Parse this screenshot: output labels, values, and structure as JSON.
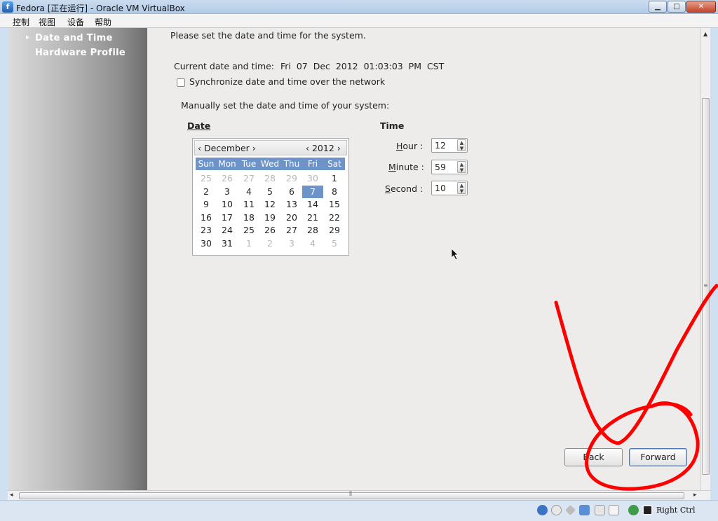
{
  "window": {
    "title": "Fedora [正在运行] - Oracle VM VirtualBox",
    "icon": "virtualbox-icon",
    "controls": {
      "minimize": "▁",
      "maximize": "□",
      "close": "✕"
    }
  },
  "menubar": {
    "items": [
      "控制",
      "视图",
      "设备",
      "帮助"
    ]
  },
  "sidebar": {
    "items": [
      {
        "label": "Date and Time",
        "active": true
      },
      {
        "label": "Hardware Profile",
        "active": false
      }
    ]
  },
  "main": {
    "intro": "Please set the date and time for the system.",
    "current_label": "Current date and time:",
    "current_value": "Fri  07  Dec  2012  01:03:03  PM  CST",
    "sync_label": "Synchronize date and time over the network",
    "sync_checked": false,
    "manual_label": "Manually set the date and time of your system:",
    "date_heading": "Date",
    "time_heading": "Time"
  },
  "calendar": {
    "month_nav": "‹ December ›",
    "year_nav": "‹ 2012 ›",
    "weekdays": [
      "Sun",
      "Mon",
      "Tue",
      "Wed",
      "Thu",
      "Fri",
      "Sat"
    ],
    "weeks": [
      [
        "25",
        "26",
        "27",
        "28",
        "29",
        "30",
        "1"
      ],
      [
        "2",
        "3",
        "4",
        "5",
        "6",
        "7",
        "8"
      ],
      [
        "9",
        "10",
        "11",
        "12",
        "13",
        "14",
        "15"
      ],
      [
        "16",
        "17",
        "18",
        "19",
        "20",
        "21",
        "22"
      ],
      [
        "23",
        "24",
        "25",
        "26",
        "27",
        "28",
        "29"
      ],
      [
        "30",
        "31",
        "1",
        "2",
        "3",
        "4",
        "5"
      ]
    ],
    "selected_day": "7"
  },
  "time": {
    "hour_label": "Hour :",
    "hour_value": "12",
    "minute_label": "Minute :",
    "minute_value": "59",
    "second_label": "Second :",
    "second_value": "10"
  },
  "buttons": {
    "back": "Back",
    "forward": "Forward"
  },
  "statusbar": {
    "host_key": "Right Ctrl"
  },
  "colors": {
    "annotation": "#ff0000",
    "calendar_accent": "#6e93c9"
  }
}
